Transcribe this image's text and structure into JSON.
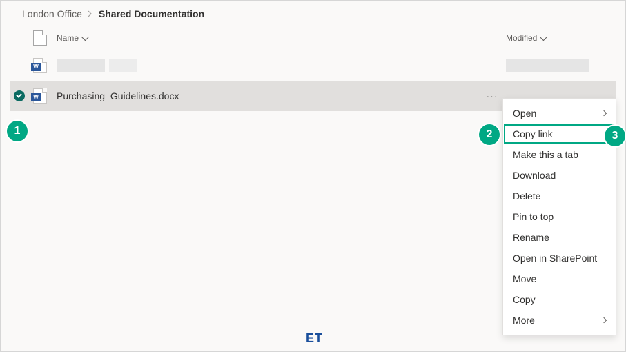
{
  "breadcrumb": {
    "root": "London Office",
    "current": "Shared Documentation"
  },
  "columns": {
    "name": "Name",
    "modified": "Modified"
  },
  "files": [
    {
      "name": "",
      "redacted": true
    },
    {
      "name": "Purchasing_Guidelines.docx",
      "redacted": false,
      "selected": true
    }
  ],
  "menu": {
    "open": "Open",
    "copy_link": "Copy link",
    "make_tab": "Make this a tab",
    "download": "Download",
    "delete": "Delete",
    "pin": "Pin to top",
    "rename": "Rename",
    "open_sp": "Open in SharePoint",
    "move": "Move",
    "copy": "Copy",
    "more": "More"
  },
  "steps": {
    "s1": "1",
    "s2": "2",
    "s3": "3"
  },
  "watermark": "ET"
}
